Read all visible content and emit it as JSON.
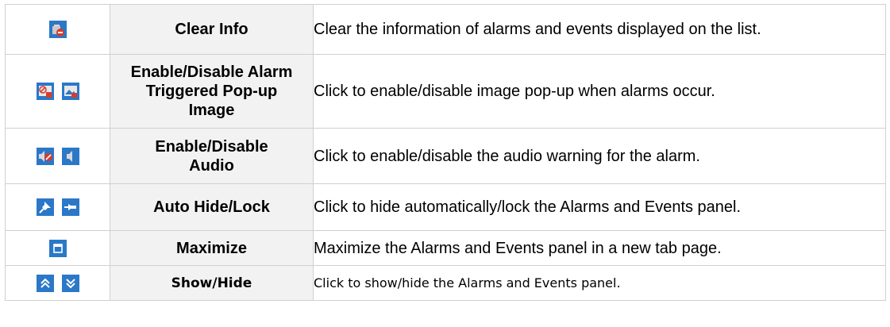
{
  "rows": [
    {
      "icons": [
        "clear-info-icon"
      ],
      "name": "Clear Info",
      "desc": "Clear the information of alarms and events displayed on the list."
    },
    {
      "icons": [
        "disable-popup-image-icon",
        "enable-popup-image-icon"
      ],
      "name": "Enable/Disable Alarm Triggered Pop-up Image",
      "desc": "Click to enable/disable image pop-up when alarms occur."
    },
    {
      "icons": [
        "audio-disabled-icon",
        "audio-enabled-icon"
      ],
      "name": "Enable/Disable Audio",
      "desc": "Click to enable/disable the audio warning for the alarm."
    },
    {
      "icons": [
        "auto-hide-pin-icon",
        "lock-pin-icon"
      ],
      "name": "Auto Hide/Lock",
      "desc": "Click to hide automatically/lock the Alarms and Events panel."
    },
    {
      "icons": [
        "maximize-icon"
      ],
      "name": "Maximize",
      "desc": "Maximize the Alarms and Events panel in a new tab page."
    },
    {
      "icons": [
        "show-chevron-up-icon",
        "hide-chevron-down-icon"
      ],
      "name": "Show/Hide",
      "desc": "Click to show/hide the Alarms and Events panel."
    }
  ],
  "colors": {
    "icon_blue": "#2b78c8",
    "icon_red": "#d83a2c",
    "header_cell_bg": "#f2f2f2",
    "border": "#d0d0d0"
  }
}
